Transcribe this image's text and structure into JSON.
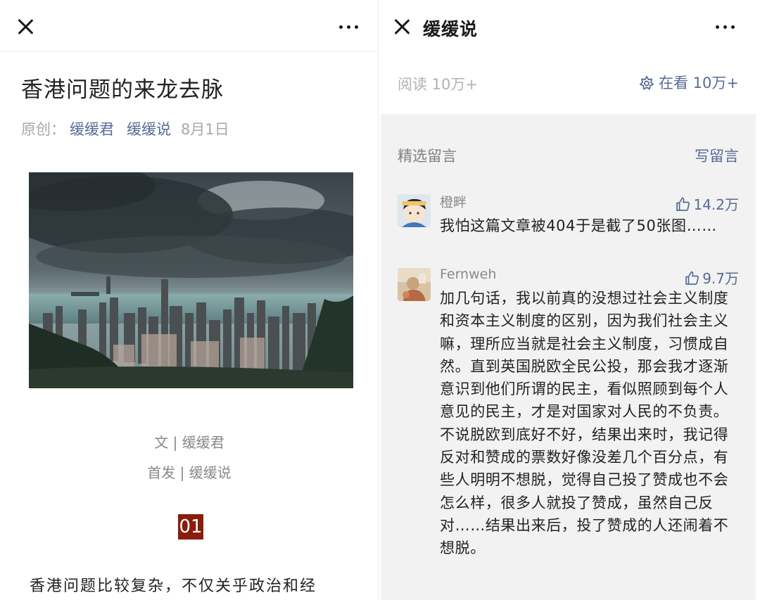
{
  "left": {
    "article_title": "香港问题的来龙去脉",
    "meta": {
      "original_label": "原创：",
      "author": "缓缓君",
      "account": "缓缓说",
      "date": "8月1日"
    },
    "credits": {
      "writer": "文 | 缓缓君",
      "first_published": "首发 | 缓缓说"
    },
    "section_number": "01",
    "body_text": "香港问题比较复杂，不仅关乎政治和经",
    "icons": {
      "close": "close-icon",
      "more": "more-icon"
    }
  },
  "right": {
    "account_name": "缓缓说",
    "read_count": "阅读 10万+",
    "watching_count": "在看 10万+",
    "featured_comments_label": "精选留言",
    "write_comment_label": "写留言",
    "comments": [
      {
        "name": "橙畔",
        "likes": "14.2万",
        "text": "我怕这篇文章被404于是截了50张图……"
      },
      {
        "name": "Fernweh",
        "likes": "9.7万",
        "text": "加几句话，我以前真的没想过社会主义制度和资本主义制度的区别，因为我们社会主义嘛，理所应当就是社会主义制度，习惯成自然。直到英国脱欧全民公投，那会我才逐渐意识到他们所谓的民主，看似照顾到每个人意见的民主，才是对国家对人民的不负责。不说脱欧到底好不好，结果出来时，我记得反对和赞成的票数好像没差几个百分点，有些人明明不想脱，觉得自己投了赞成也不会怎么样，很多人就投了赞成，虽然自己反对……结果出来后，投了赞成的人还闹着不想脱。"
      }
    ],
    "icons": {
      "close": "close-icon",
      "more": "more-icon",
      "watch": "flower-icon",
      "like": "thumbs-up-icon"
    }
  },
  "colors": {
    "link": "#576b95",
    "section_badge": "#8a1c0c",
    "comments_bg": "#f2f2f2"
  }
}
